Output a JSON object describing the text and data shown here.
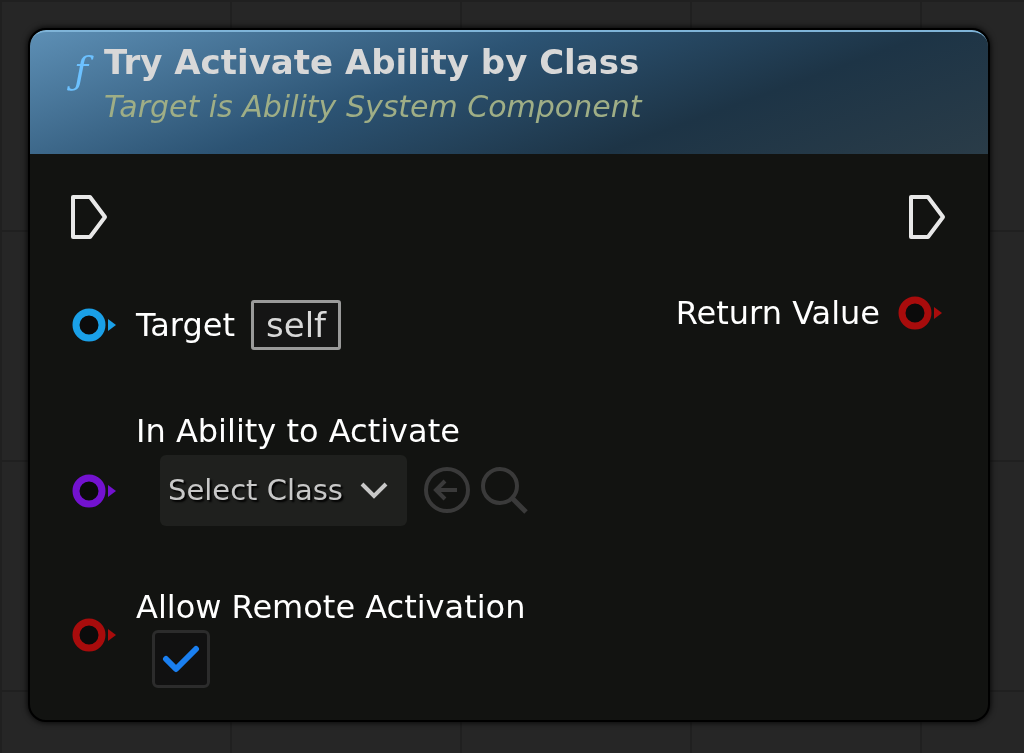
{
  "node": {
    "icon": "ƒ",
    "title": "Try Activate Ability by Class",
    "subtitle": "Target is Ability System Component",
    "exec_in": true,
    "exec_out": true,
    "inputs": [
      {
        "label": "Target",
        "color": "#1aa0e8",
        "default": {
          "kind": "text",
          "value": "self"
        }
      },
      {
        "label": "In Ability to Activate",
        "color": "#7312d0",
        "default": {
          "kind": "dropdown",
          "value": "Select Class"
        }
      },
      {
        "label": "Allow Remote Activation",
        "color": "#a80c0c",
        "default": {
          "kind": "checkbox",
          "checked": true
        }
      }
    ],
    "outputs": [
      {
        "label": "Return Value",
        "color": "#a80c0c"
      }
    ]
  }
}
